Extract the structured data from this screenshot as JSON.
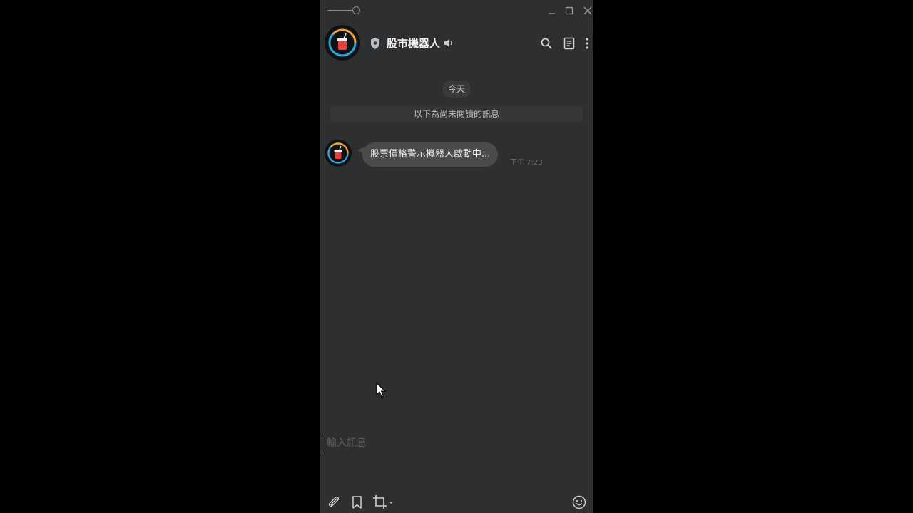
{
  "window": {
    "background": "#2e2f30",
    "controls": {
      "pin": "pin-slider-icon",
      "minimize": "minimize-icon",
      "maximize": "maximize-icon",
      "close": "close-icon"
    }
  },
  "header": {
    "title": "股市機器人",
    "icons": [
      "shield-icon",
      "speaker-icon",
      "search-icon",
      "notes-icon",
      "more-icon"
    ],
    "avatar": "robot-cup-avatar"
  },
  "chat": {
    "date_separator": "今天",
    "unread_divider": "以下為尚未閱讀的訊息",
    "messages": [
      {
        "text": "股票價格警示機器人啟動中...",
        "time": "下午 7:23",
        "avatar": "robot-cup-avatar"
      }
    ]
  },
  "composer": {
    "placeholder": "輸入訊息",
    "value": "",
    "tools": [
      "attach-icon",
      "bookmark-icon",
      "crop-icon",
      "emoji-icon"
    ]
  },
  "colors": {
    "accent_ring_blue": "#2ea7e0",
    "accent_ring_orange": "#f0a23c",
    "cup_red": "#e0413c",
    "bubble": "#4a4b4d"
  }
}
